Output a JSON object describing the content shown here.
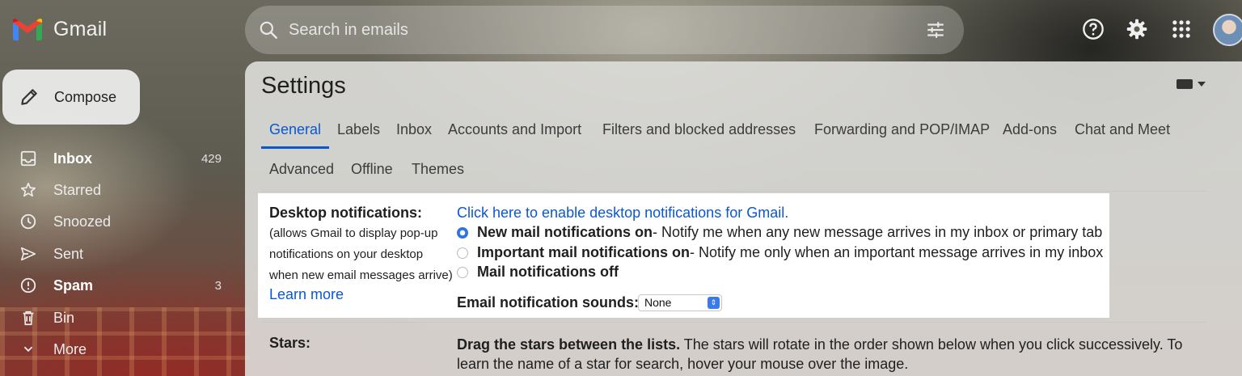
{
  "app": {
    "name": "Gmail",
    "logo_icon": "gmail-m-logo"
  },
  "search": {
    "placeholder": "Search in emails"
  },
  "header_icons": [
    "help-icon",
    "settings-icon",
    "apps-grid-icon",
    "account-avatar"
  ],
  "compose": {
    "label": "Compose"
  },
  "nav": [
    {
      "label": "Inbox",
      "count": "429",
      "icon": "inbox-icon",
      "bold": true
    },
    {
      "label": "Starred",
      "count": "",
      "icon": "star-icon",
      "bold": false
    },
    {
      "label": "Snoozed",
      "count": "",
      "icon": "clock-icon",
      "bold": false
    },
    {
      "label": "Sent",
      "count": "",
      "icon": "send-icon",
      "bold": false
    },
    {
      "label": "Spam",
      "count": "3",
      "icon": "spam-icon",
      "bold": true
    },
    {
      "label": "Bin",
      "count": "",
      "icon": "trash-icon",
      "bold": false
    },
    {
      "label": "More",
      "count": "",
      "icon": "chevron-down-icon",
      "bold": false
    }
  ],
  "settings": {
    "title": "Settings",
    "tabs": [
      "General",
      "Labels",
      "Inbox",
      "Accounts and Import",
      "Filters and blocked addresses",
      "Forwarding and POP/IMAP",
      "Add-ons",
      "Chat and Meet",
      "Advanced",
      "Offline",
      "Themes"
    ],
    "active_tab": "General"
  },
  "desktop_notifications": {
    "title": "Desktop notifications:",
    "description_lines": [
      "(allows Gmail to display pop-up",
      "notifications on your desktop",
      "when new email messages arrive)"
    ],
    "learn_more": "Learn more",
    "enable_link": "Click here to enable desktop notifications for Gmail.",
    "options": [
      {
        "label": "New mail notifications on",
        "detail": " - Notify me when any new message arrives in my inbox or primary tab",
        "selected": true
      },
      {
        "label": "Important mail notifications on",
        "detail": " - Notify me only when an important message arrives in my inbox",
        "selected": false
      },
      {
        "label": "Mail notifications off",
        "detail": "",
        "selected": false
      }
    ],
    "sound_label": "Email notification sounds:",
    "sound_value": "None"
  },
  "stars": {
    "label": "Stars:",
    "bold_text": "Drag the stars between the lists.",
    "text": " The stars will rotate in the order shown below when you click successively. To learn the name of a star for search, hover your mouse over the image."
  },
  "colors": {
    "accent": "#0b57d0",
    "radio_on": "#2f74e0",
    "panel_bg": "#dedeDA"
  }
}
